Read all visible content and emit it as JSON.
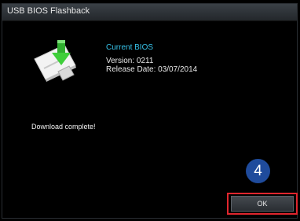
{
  "window": {
    "title": "USB BIOS Flashback"
  },
  "bios": {
    "heading": "Current BIOS",
    "version_line": "Version:  0211",
    "release_line": "Release Date:  03/07/2014"
  },
  "status": {
    "message": "Download complete!"
  },
  "annotation": {
    "step_number": "4",
    "badge_color": "#1f4b9c",
    "highlight_color": "#e0262e"
  },
  "buttons": {
    "ok_label": "OK"
  },
  "icons": {
    "drive": "usb-flash-drive-icon",
    "arrow": "download-arrow-icon"
  }
}
